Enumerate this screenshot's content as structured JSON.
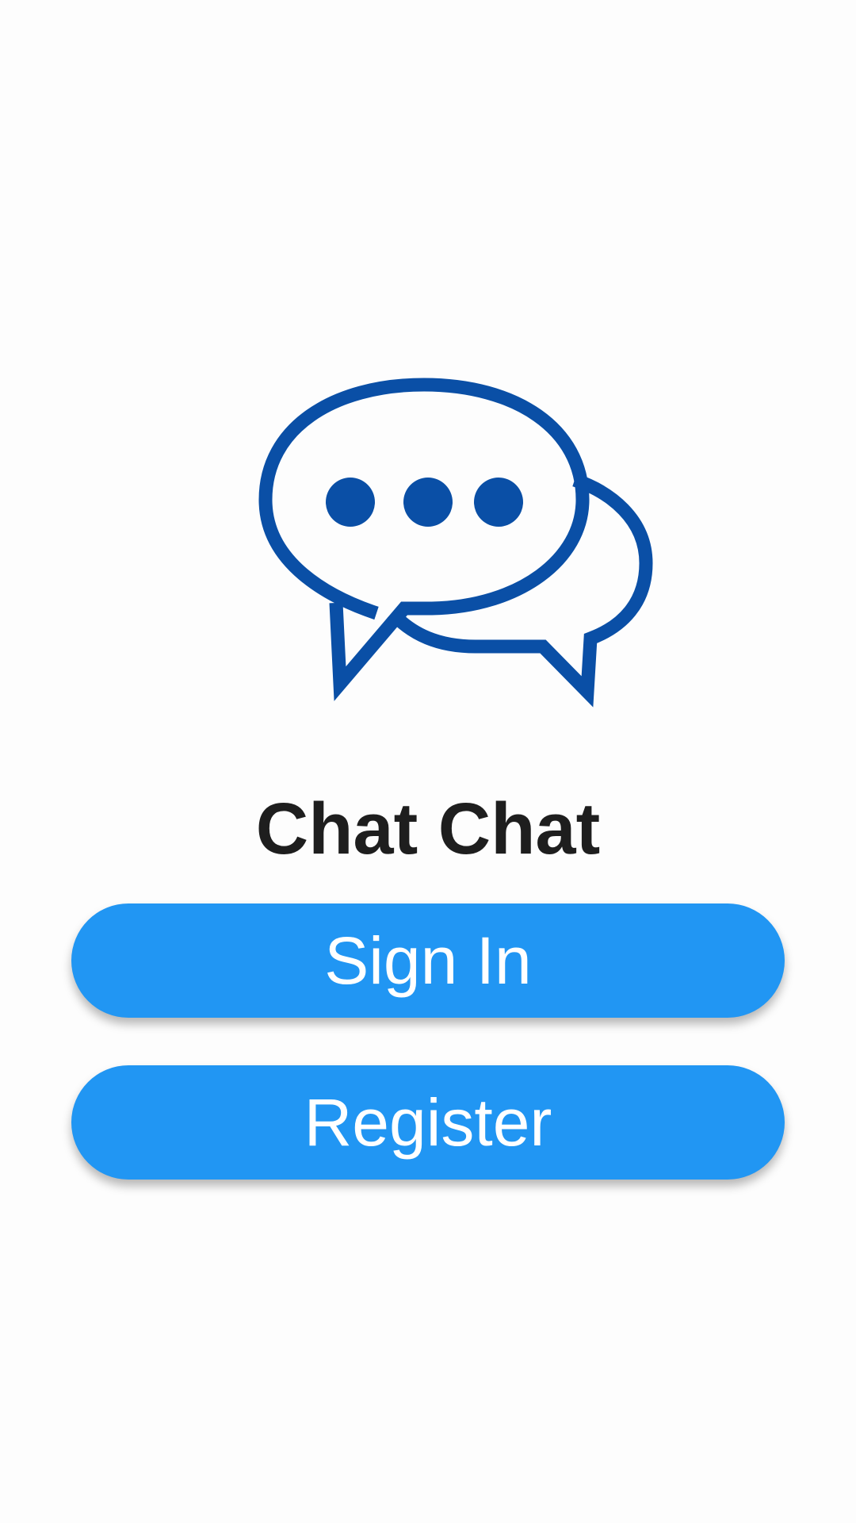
{
  "app": {
    "title": "Chat Chat",
    "logo_icon": "chat-bubbles-icon"
  },
  "actions": {
    "sign_in_label": "Sign In",
    "register_label": "Register"
  },
  "colors": {
    "background": "#fdfdfd",
    "logo": "#0a4fa6",
    "button": "#2196f3",
    "button_text": "#ffffff",
    "title_text": "#1e1e1e"
  }
}
